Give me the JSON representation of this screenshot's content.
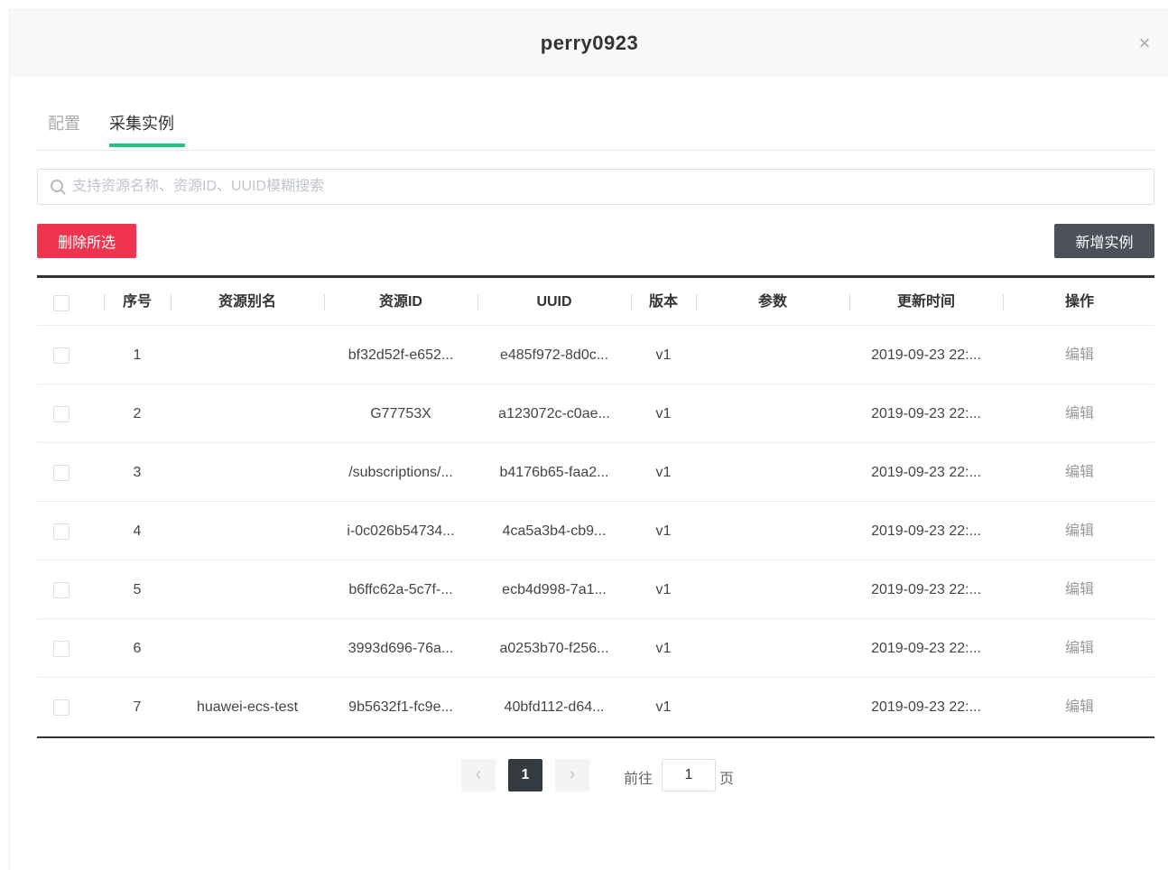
{
  "modal": {
    "title": "perry0923",
    "close_icon": "close-icon"
  },
  "tabs": [
    {
      "label": "配置",
      "active": false
    },
    {
      "label": "采集实例",
      "active": true
    }
  ],
  "search": {
    "placeholder": "支持资源名称、资源ID、UUID模糊搜索",
    "value": "",
    "icon": "search-icon"
  },
  "toolbar": {
    "delete_label": "删除所选",
    "add_label": "新增实例"
  },
  "colors": {
    "accent_tab": "#21c47a",
    "danger": "#f0344f",
    "dark_button": "#4b5059",
    "active_page": "#333a40"
  },
  "table": {
    "columns": [
      "序号",
      "资源别名",
      "资源ID",
      "UUID",
      "版本",
      "参数",
      "更新时间",
      "操作"
    ],
    "rows": [
      {
        "index": "1",
        "alias": "",
        "resource_id": "bf32d52f-e652...",
        "uuid": "e485f972-8d0c...",
        "version": "v1",
        "params": "",
        "updated": "2019-09-23 22:...",
        "action": "编辑"
      },
      {
        "index": "2",
        "alias": "",
        "resource_id": "G77753X",
        "uuid": "a123072c-c0ae...",
        "version": "v1",
        "params": "",
        "updated": "2019-09-23 22:...",
        "action": "编辑"
      },
      {
        "index": "3",
        "alias": "",
        "resource_id": "/subscriptions/...",
        "uuid": "b4176b65-faa2...",
        "version": "v1",
        "params": "",
        "updated": "2019-09-23 22:...",
        "action": "编辑"
      },
      {
        "index": "4",
        "alias": "",
        "resource_id": "i-0c026b54734...",
        "uuid": "4ca5a3b4-cb9...",
        "version": "v1",
        "params": "",
        "updated": "2019-09-23 22:...",
        "action": "编辑"
      },
      {
        "index": "5",
        "alias": "",
        "resource_id": "b6ffc62a-5c7f-...",
        "uuid": "ecb4d998-7a1...",
        "version": "v1",
        "params": "",
        "updated": "2019-09-23 22:...",
        "action": "编辑"
      },
      {
        "index": "6",
        "alias": "",
        "resource_id": "3993d696-76a...",
        "uuid": "a0253b70-f256...",
        "version": "v1",
        "params": "",
        "updated": "2019-09-23 22:...",
        "action": "编辑"
      },
      {
        "index": "7",
        "alias": "huawei-ecs-test",
        "resource_id": "9b5632f1-fc9e...",
        "uuid": "40bfd112-d64...",
        "version": "v1",
        "params": "",
        "updated": "2019-09-23 22:...",
        "action": "编辑"
      }
    ]
  },
  "pagination": {
    "prev": "‹",
    "next": "›",
    "current": "1",
    "goto_label": "前往",
    "goto_value": "1",
    "page_suffix": "页"
  }
}
